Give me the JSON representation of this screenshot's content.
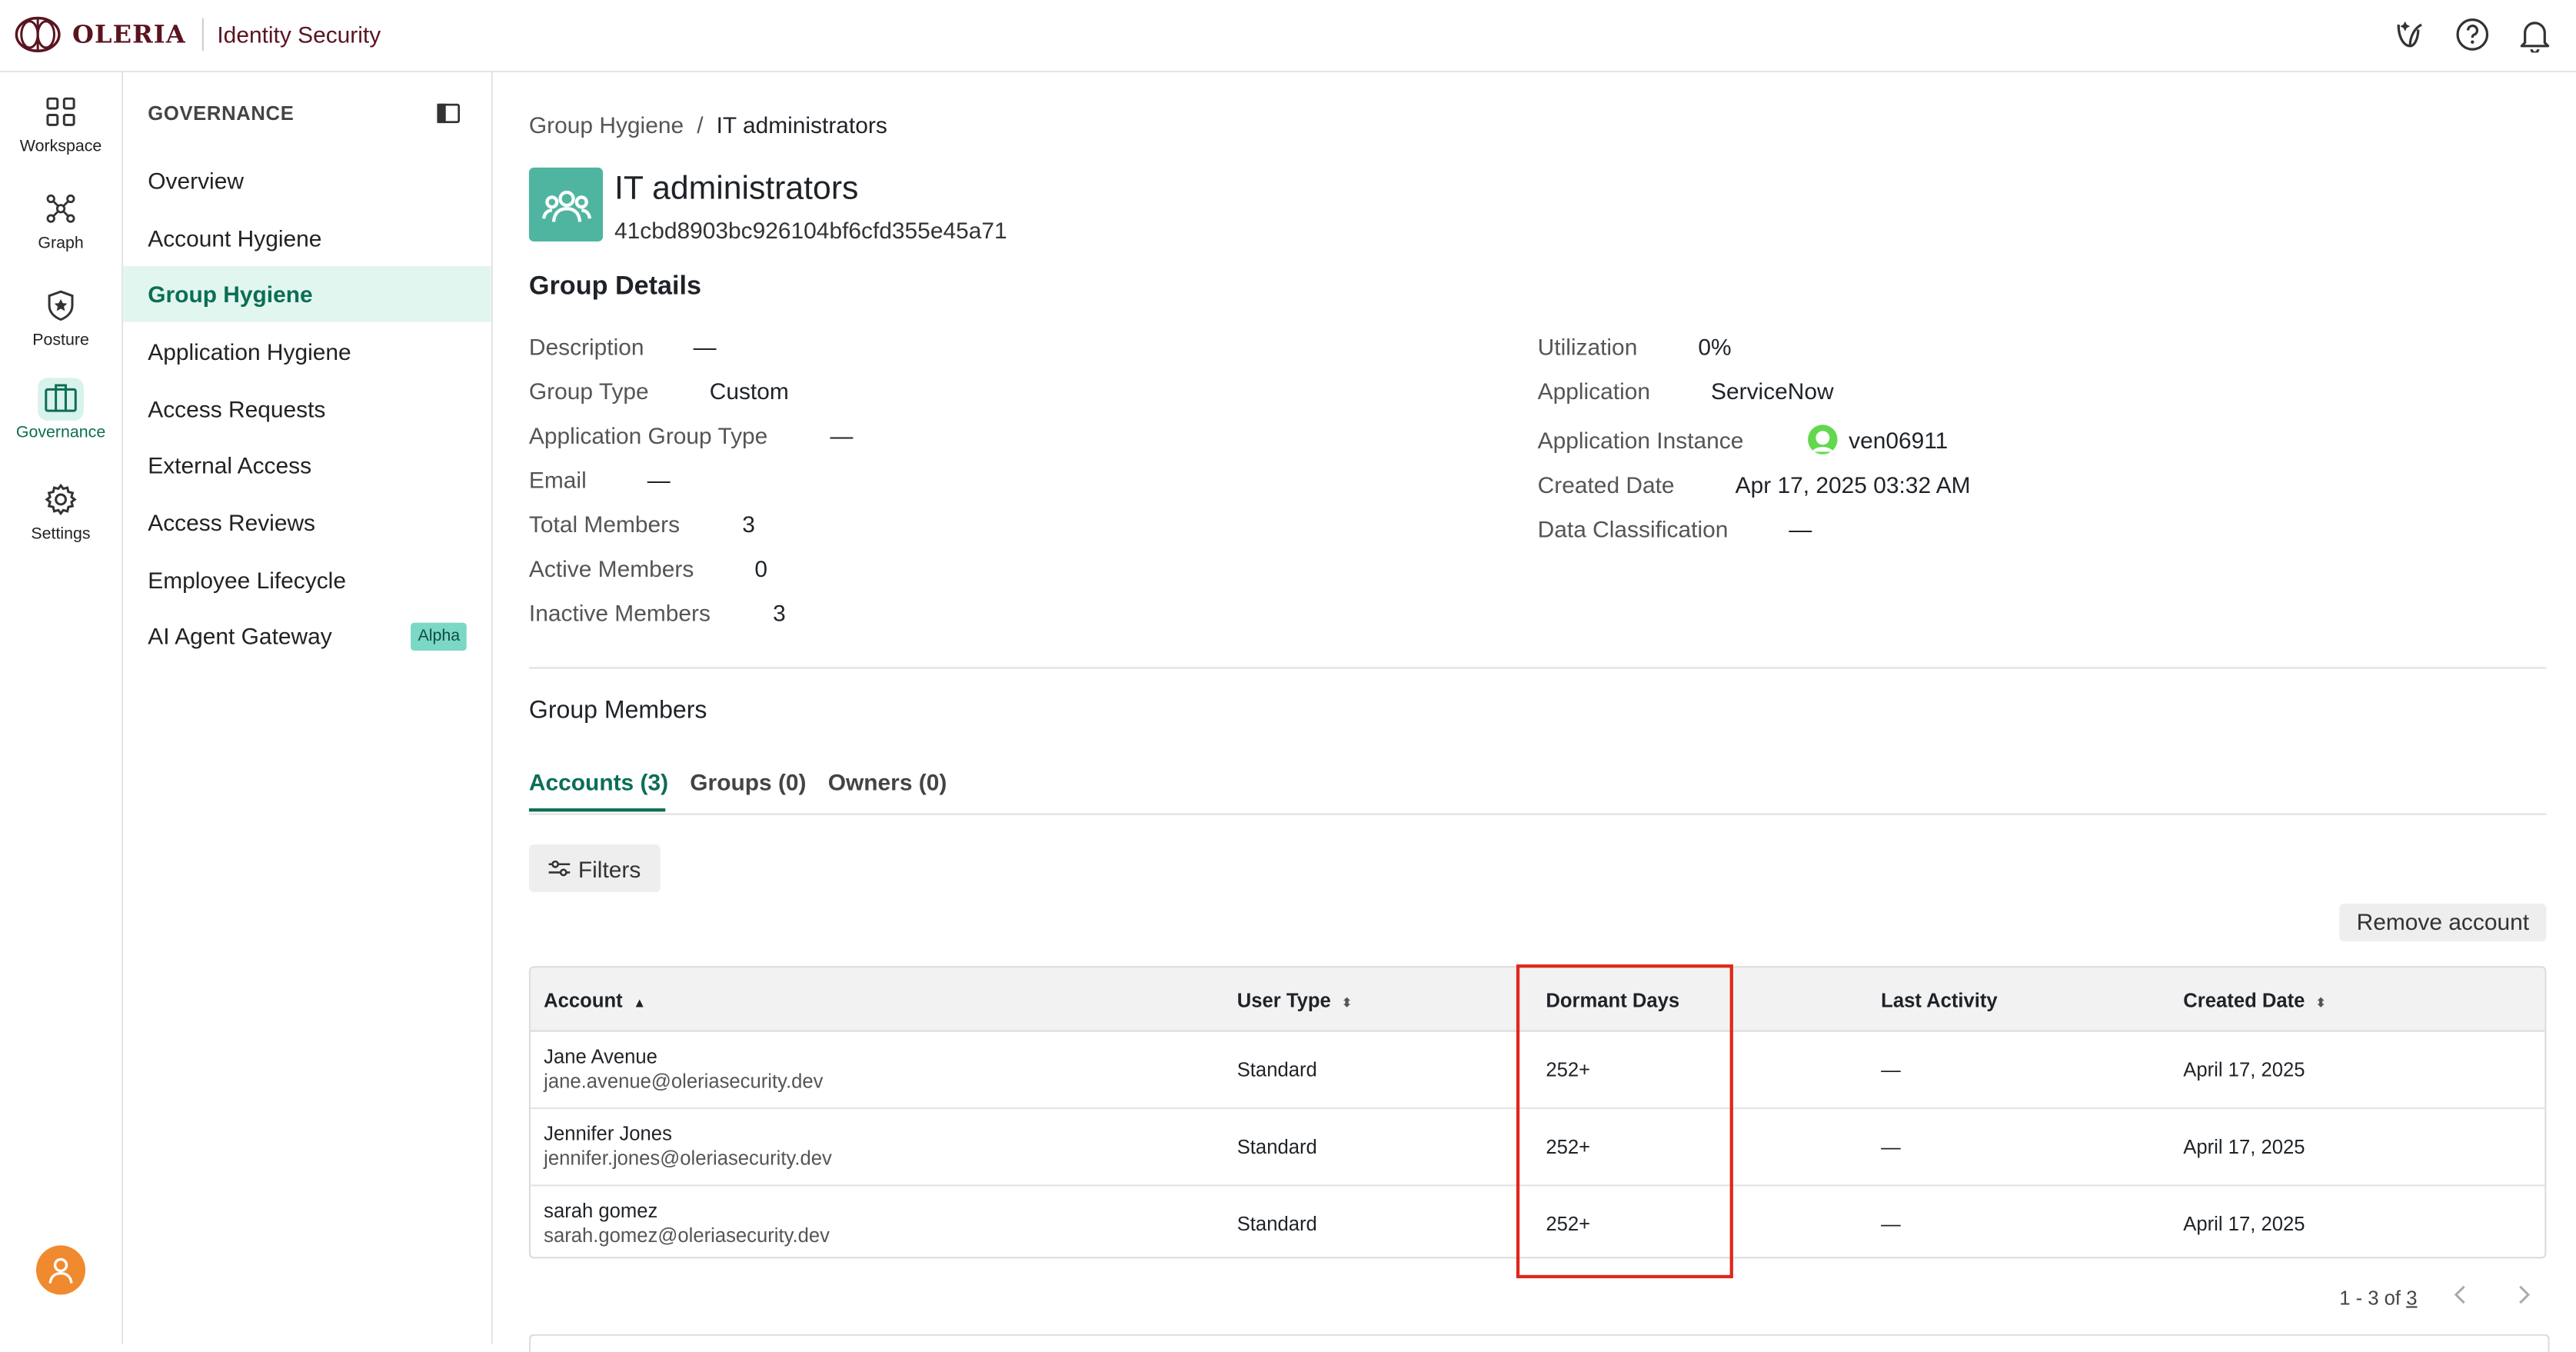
{
  "app": {
    "brand": "OLERIA",
    "product": "Identity Security"
  },
  "rail": {
    "items": [
      {
        "label": "Workspace",
        "icon": "grid-icon"
      },
      {
        "label": "Graph",
        "icon": "graph-icon"
      },
      {
        "label": "Posture",
        "icon": "shield-star-icon"
      },
      {
        "label": "Governance",
        "icon": "briefcase-icon",
        "active": true
      },
      {
        "label": "Settings",
        "icon": "gear-icon"
      }
    ]
  },
  "sidebar": {
    "heading": "GOVERNANCE",
    "items": [
      {
        "label": "Overview"
      },
      {
        "label": "Account Hygiene"
      },
      {
        "label": "Group Hygiene",
        "active": true
      },
      {
        "label": "Application Hygiene"
      },
      {
        "label": "Access Requests"
      },
      {
        "label": "External Access"
      },
      {
        "label": "Access Reviews"
      },
      {
        "label": "Employee Lifecycle"
      },
      {
        "label": "AI Agent Gateway",
        "badge": "Alpha"
      }
    ]
  },
  "breadcrumb": {
    "parent": "Group Hygiene",
    "separator": "/",
    "current": "IT administrators"
  },
  "group": {
    "name": "IT administrators",
    "id": "41cbd8903bc926104bf6cfd355e45a71"
  },
  "details": {
    "title": "Group Details",
    "left": [
      {
        "label": "Description",
        "value": "—"
      },
      {
        "label": "Group Type",
        "value": "Custom"
      },
      {
        "label": "Application Group Type",
        "value": "—"
      },
      {
        "label": "Email",
        "value": "—"
      },
      {
        "label": "Total Members",
        "value": "3"
      },
      {
        "label": "Active Members",
        "value": "0"
      },
      {
        "label": "Inactive Members",
        "value": "3"
      }
    ],
    "right": [
      {
        "label": "Utilization",
        "value": "0%"
      },
      {
        "label": "Application",
        "value": "ServiceNow"
      },
      {
        "label": "Application Instance",
        "value": "ven06911"
      },
      {
        "label": "Created Date",
        "value": "Apr 17, 2025 03:32 AM"
      },
      {
        "label": "Data Classification",
        "value": "—"
      }
    ]
  },
  "members": {
    "title": "Group Members",
    "tabs": [
      {
        "label": "Accounts (3)",
        "active": true
      },
      {
        "label": "Groups (0)"
      },
      {
        "label": "Owners (0)"
      }
    ],
    "filters_label": "Filters",
    "remove_label": "Remove account",
    "columns": [
      "Account",
      "User Type",
      "Dormant Days",
      "Last Activity",
      "Created Date"
    ],
    "rows": [
      {
        "name": "Jane Avenue",
        "email": "jane.avenue@oleriasecurity.dev",
        "user_type": "Standard",
        "dormant": "252+",
        "last_activity": "—",
        "created": "April 17, 2025"
      },
      {
        "name": "Jennifer Jones",
        "email": "jennifer.jones@oleriasecurity.dev",
        "user_type": "Standard",
        "dormant": "252+",
        "last_activity": "—",
        "created": "April 17, 2025"
      },
      {
        "name": "sarah gomez",
        "email": "sarah.gomez@oleriasecurity.dev",
        "user_type": "Standard",
        "dormant": "252+",
        "last_activity": "—",
        "created": "April 17, 2025"
      }
    ],
    "pager": {
      "range": "1 - 3 of",
      "total": "3"
    }
  },
  "colors": {
    "accent": "#0b6e55",
    "highlight": "#e0271a",
    "avatar": "#f08a2e",
    "group_icon": "#4fb5a0"
  }
}
